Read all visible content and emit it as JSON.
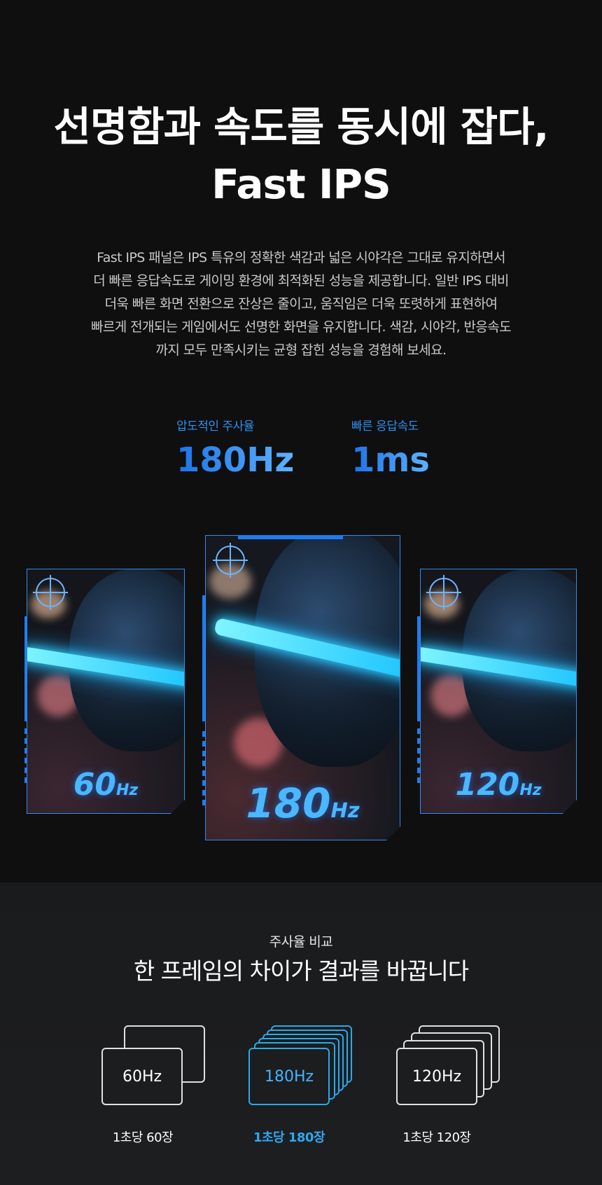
{
  "headline": {
    "line1": "선명함과 속도를 동시에 잡다,",
    "line2": "Fast IPS"
  },
  "description": {
    "line1": "Fast IPS 패널은 IPS 특유의 정확한 색감과 넓은 시야각은 그대로 유지하면서",
    "line2": "더 빠른 응답속도로 게이밍 환경에 최적화된 성능을 제공합니다. 일반 IPS 대비",
    "line3": "더욱 빠른 화면 전환으로 잔상은 줄이고, 움직임은 더욱 또렷하게 표현하여",
    "line4": "빠르게 전개되는 게임에서도 선명한 화면을 유지합니다. 색감, 시야각, 반응속도",
    "line5": "까지 모두 만족시키는 균형 잡힌 성능을 경험해 보세요."
  },
  "stats": [
    {
      "label": "압도적인 주사율",
      "value": "180Hz"
    },
    {
      "label": "빠른 응답속도",
      "value": "1ms"
    }
  ],
  "cards": [
    {
      "hz_number": "60",
      "hz_unit": "Hz"
    },
    {
      "hz_number": "180",
      "hz_unit": "Hz"
    },
    {
      "hz_number": "120",
      "hz_unit": "Hz"
    }
  ],
  "comparison": {
    "tag": "주사율 비교",
    "title": "한 프레임의 차이가 결과를 바꿉니다",
    "items": [
      {
        "label": "60Hz",
        "caption": "1초당 60장"
      },
      {
        "label": "180Hz",
        "caption": "1초당 180장"
      },
      {
        "label": "120Hz",
        "caption": "1초당 120장"
      }
    ]
  },
  "colors": {
    "accent": "#2f8ff0",
    "frame_blue": "#2ca8e8",
    "background": "#0f0f10"
  }
}
